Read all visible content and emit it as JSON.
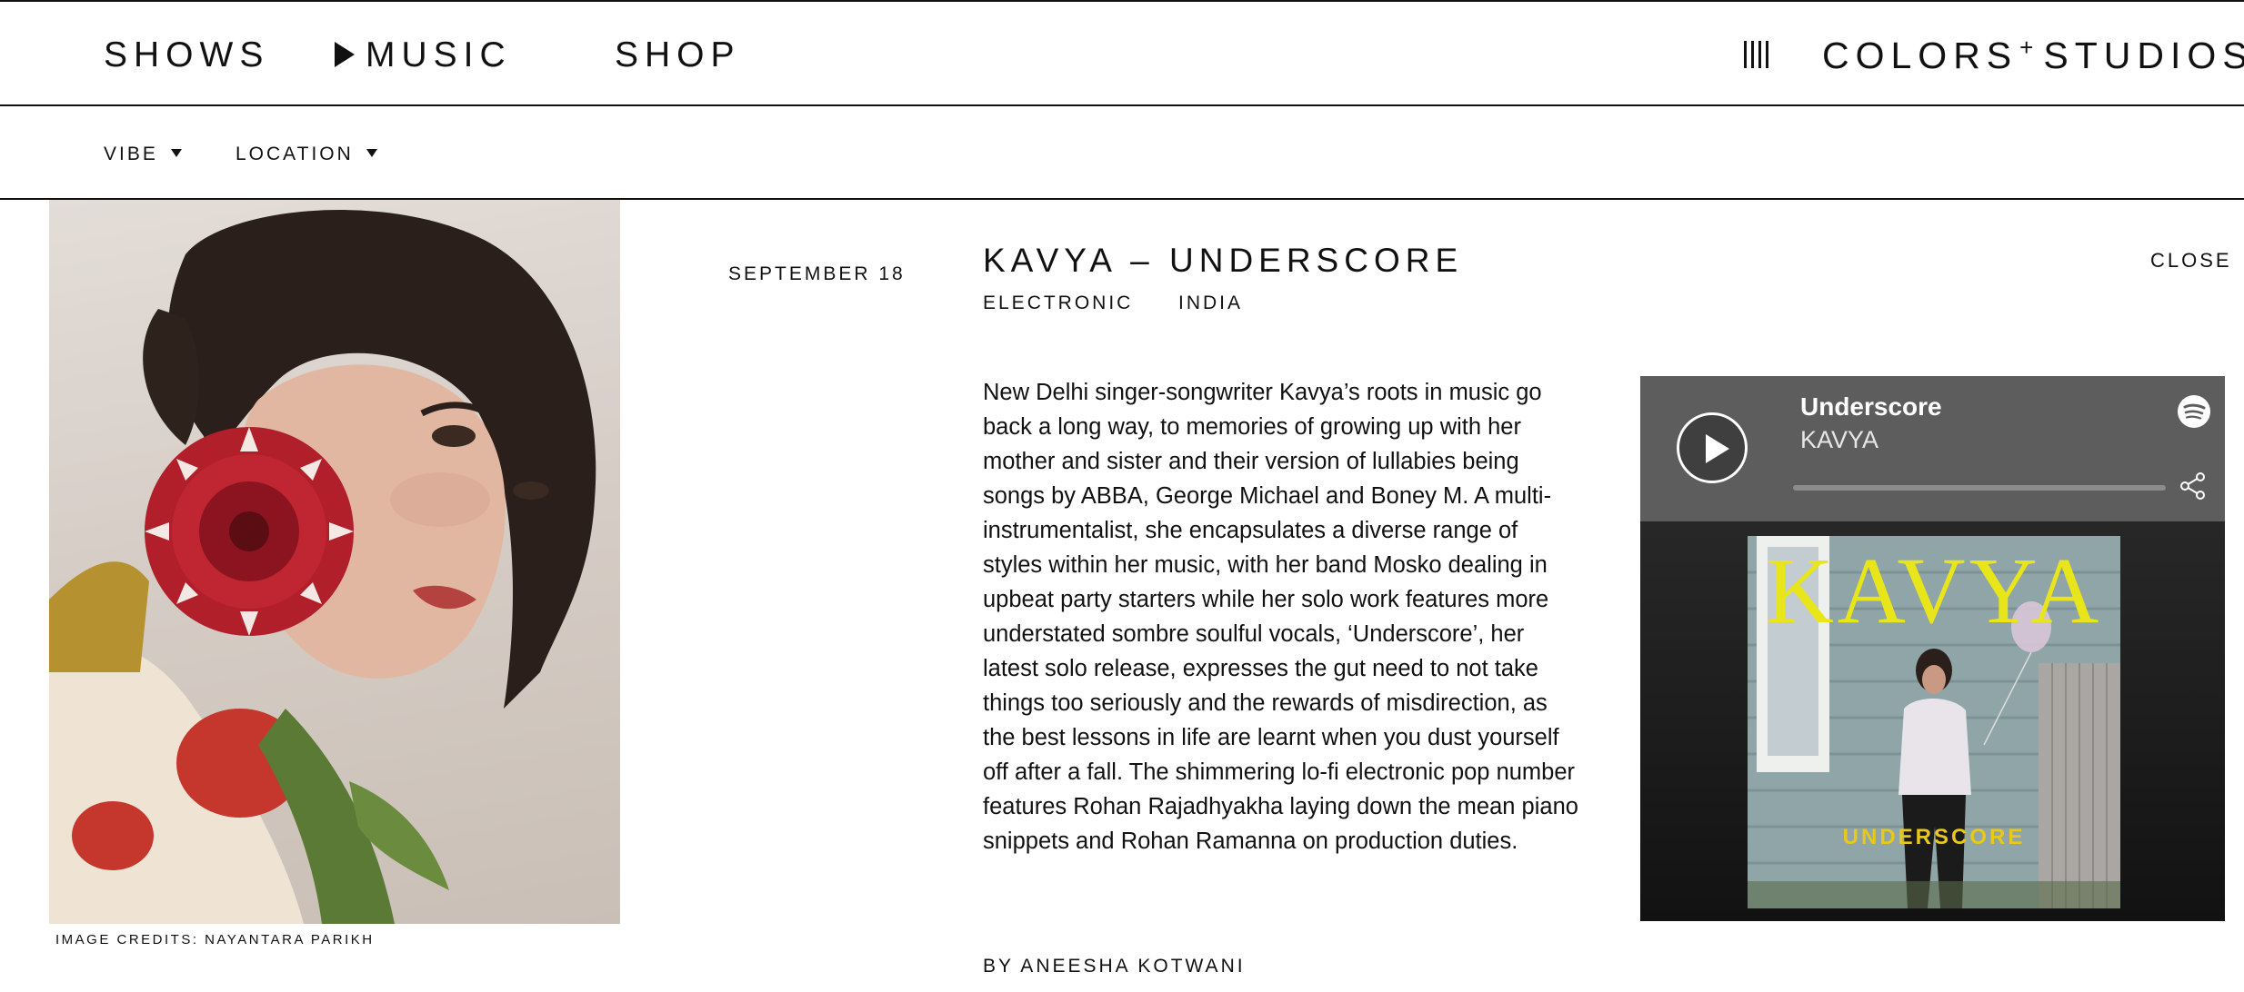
{
  "nav": {
    "shows": "SHOWS",
    "music": "MUSIC",
    "shop": "SHOP",
    "brand_left": "COLORS",
    "brand_sep": "+",
    "brand_right": "STUDIOS"
  },
  "filters": {
    "vibe": "VIBE",
    "location": "LOCATION"
  },
  "article": {
    "date": "SEPTEMBER 18",
    "title": "KAVYA – UNDERSCORE",
    "genre": "ELECTRONIC",
    "location": "INDIA",
    "close": "CLOSE",
    "body": "New Delhi singer-songwriter Kavya’s roots in music go back a long way, to memories of growing up with her mother and sister and their version of lullabies being songs by ABBA, George Michael and Boney M. A multi-instrumentalist, she encapsulates a diverse range of styles within her music, with her band Mosko dealing in upbeat party starters while her solo work features more understated sombre soulful vocals, ‘Underscore’, her latest solo release, expresses the gut need to not take things too seriously and the rewards of misdirection, as the best lessons in life are learnt when you dust yourself off after a fall. The shimmering lo-fi electronic pop number features Rohan Rajadhyakha laying down the mean piano snippets and Rohan Ramanna on production duties.",
    "byline": "BY ANEESHA KOTWANI",
    "image_credits": "IMAGE CREDITS: NAYANTARA PARIKH"
  },
  "player": {
    "track": "Underscore",
    "artist": "KAVYA",
    "cover_title": "KAVYA",
    "cover_subtitle": "UNDERSCORE",
    "icons": [
      "play-icon",
      "spotify-icon",
      "share-icon"
    ]
  },
  "colors": {
    "text": "#111111",
    "player_header": "#5d5d5d",
    "cover_title": "#e8e61a"
  }
}
